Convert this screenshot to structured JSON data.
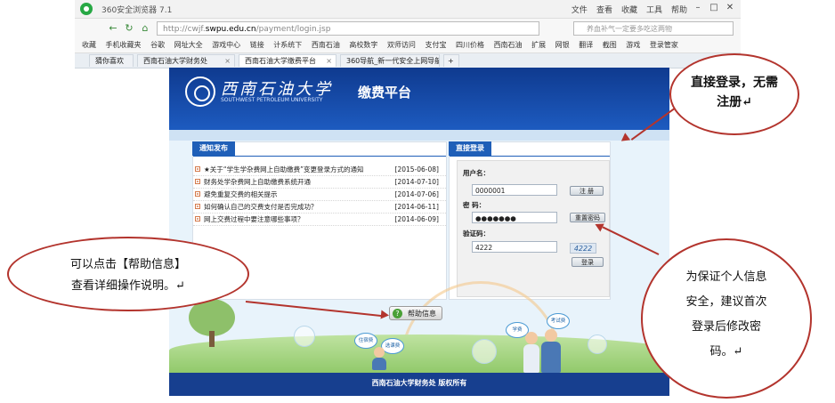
{
  "browser": {
    "title": "360安全浏览器 7.1",
    "menu": [
      "文件",
      "查看",
      "收藏",
      "工具",
      "帮助"
    ],
    "url_prefix": "http://cwjf.",
    "url_domain": "swpu.edu.cn",
    "url_path": "/payment/login.jsp",
    "search_placeholder": "养血补气一定要多吃这两物",
    "bookmarks": [
      "收藏",
      "手机收藏夹",
      "谷歌",
      "网址大全",
      "游戏中心",
      "链接",
      "计系统下",
      "西南石油",
      "高校数字",
      "双师访问",
      "支付宝",
      "四川价格",
      "西南石油"
    ],
    "bookmark_tools": [
      "扩展",
      "网银",
      "翻译",
      "截图",
      "游戏",
      "登录管家"
    ],
    "tabs": [
      {
        "label": "猜你喜欢",
        "active": false
      },
      {
        "label": "西南石油大学财务处",
        "active": false
      },
      {
        "label": "西南石油大学缴费平台",
        "active": true
      },
      {
        "label": "360导航_新一代安全上网导航",
        "active": false
      }
    ]
  },
  "site": {
    "university_cn": "西南石油大学",
    "university_en": "SOUTHWEST PETROLEUM UNIVERSITY",
    "platform_name": "缴费平台",
    "news_tab": "通知发布",
    "news": [
      {
        "title": "★关于“学生学杂费网上自助缴费”变更登录方式的通知",
        "date": "[2015-06-08]"
      },
      {
        "title": "财务处学杂费网上自助缴费系统开通",
        "date": "[2014-07-10]"
      },
      {
        "title": "避免重复交费的相关提示",
        "date": "[2014-07-06]"
      },
      {
        "title": "如何确认自己的交费支付是否完成功？",
        "date": "[2014-06-11]"
      },
      {
        "title": "网上交费过程中要注意哪些事项？",
        "date": "[2014-06-09]"
      }
    ],
    "login_tab": "直接登录",
    "login": {
      "username_label": "用户名：",
      "username_value": "0000001",
      "register_button": "注 册",
      "password_label": "密 码：",
      "password_value": "●●●●●●●",
      "reset_button": "重置密码",
      "captcha_label": "验证码：",
      "captcha_value": "4222",
      "captcha_image_text": "4222",
      "login_button": "登录"
    },
    "help_button": "帮助信息",
    "scene_labels": [
      "学费",
      "考试费",
      "住宿费",
      "选课费"
    ],
    "footer": "西南石油大学财务处  版权所有"
  },
  "annotations": {
    "top_right": "直接登录，无需注册↵",
    "left": [
      "可以点击【帮助信息】",
      "查看详细操作说明。↵"
    ],
    "bottom_right": [
      "为保证个人信息",
      "安全，建议首次",
      "登录后修改密",
      "码。↵"
    ]
  },
  "colors": {
    "header_blue": "#1d5bc0",
    "panel_tab_blue": "#1f5fb8",
    "annotation_red": "#b3342d"
  }
}
